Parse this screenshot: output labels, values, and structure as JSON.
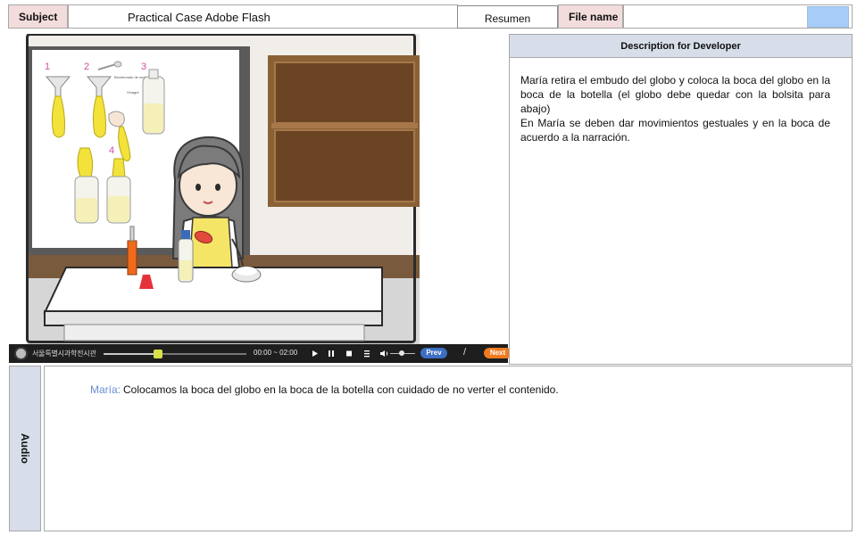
{
  "header": {
    "subject_label": "Subject",
    "subject_value": "Practical Case Adobe Flash",
    "resumen_button": "Resumen",
    "file_name_label": "File name",
    "file_name_swatch_color": "#a7cef8"
  },
  "description": {
    "title": "Description for Developer",
    "paragraph1": "María retira el embudo del globo y coloca la boca del globo en la boca de la botella (el globo debe quedar con la bolsita para abajo)",
    "paragraph2": "En María se deben dar movimientos gestuales y en la boca de acuerdo a la narración."
  },
  "stage": {
    "board_step_numbers": [
      "1",
      "2",
      "3",
      "4"
    ],
    "board_label_a": "Bicarbonato de sodio",
    "board_label_b": "Vinagre"
  },
  "player": {
    "logo_text": "서울특별시과학전시관",
    "time": "00:00 ~ 02:00",
    "progress_fraction": 0.38,
    "volume_fraction": 0.45,
    "prev_label": "Prev",
    "separator": "/",
    "next_label": "Next",
    "icons": [
      "play-icon",
      "pause-icon",
      "stop-icon",
      "menu-icon",
      "volume-icon"
    ]
  },
  "audio": {
    "tab_label": "Audio",
    "speaker": "María:",
    "line": "Colocamos la boca del globo en la boca de la botella con cuidado de no verter el contenido."
  }
}
